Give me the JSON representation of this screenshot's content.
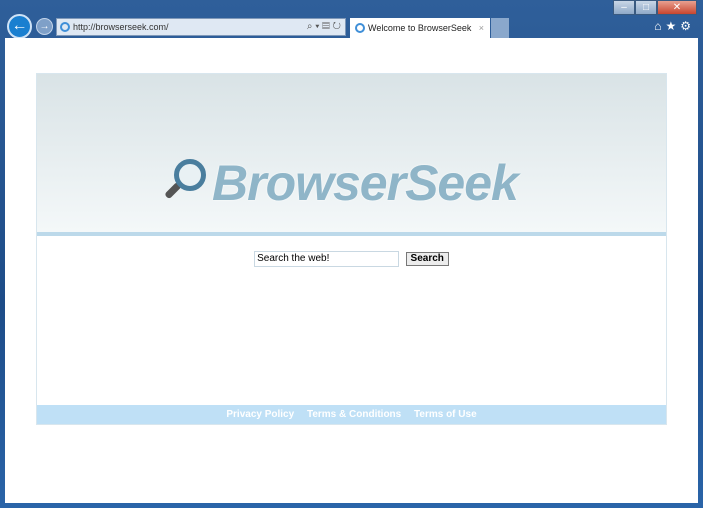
{
  "browser": {
    "url": "http://browserseek.com/",
    "tab_title": "Welcome to BrowserSeek",
    "tab_close": "×",
    "minimize": "–",
    "maximize": "□",
    "close": "✕",
    "back": "←",
    "forward": "→",
    "tools": "⌕ ▾ ▤ ↻",
    "right_tools": "⌂★⚙"
  },
  "page": {
    "logo_text": "BrowserSeek",
    "search_value": "Search the web!",
    "search_button": "Search",
    "footer_links": [
      "Privacy Policy",
      "Terms & Conditions",
      "Terms of Use"
    ]
  }
}
